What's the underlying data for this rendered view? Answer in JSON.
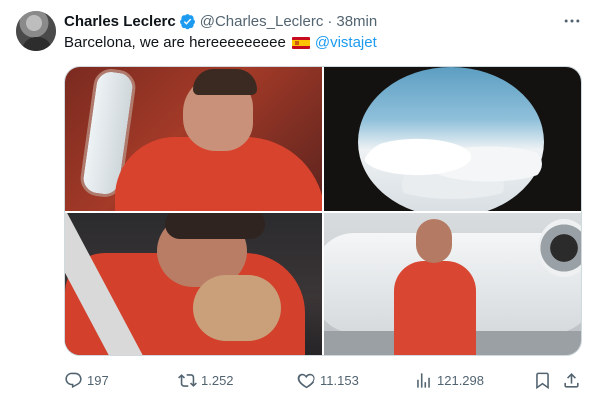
{
  "tweet": {
    "author_name": "Charles Leclerc",
    "handle": "@Charles_Leclerc",
    "separator": "·",
    "time": "38min",
    "text": "Barcelona, we are hereeeeeeeee",
    "flag_emoji": "spain-flag",
    "mention": "@vistajet",
    "verified_color": "#1d9bf0"
  },
  "actions": {
    "replies": "197",
    "retweets": "1.252",
    "likes": "11.153",
    "views": "121.298"
  },
  "icons": {
    "more": "more-dots-icon",
    "reply": "reply-icon",
    "retweet": "retweet-icon",
    "like": "heart-icon",
    "views": "views-icon",
    "bookmark": "bookmark-icon",
    "share": "share-icon"
  },
  "colors": {
    "text": "#0f1419",
    "muted": "#536471",
    "link": "#1d9bf0"
  }
}
